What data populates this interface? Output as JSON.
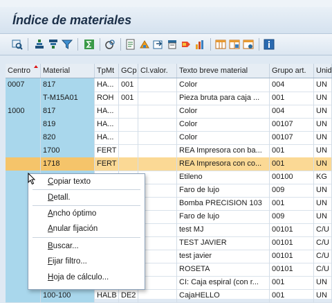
{
  "window": {
    "title": "Índice de materiales"
  },
  "toolbar": {
    "icons": [
      "details-icon",
      "sort-ascending-icon",
      "sort-descending-icon",
      "filter-icon",
      "sum-icon",
      "subtotals-icon",
      "print-preview-icon",
      "export-icon",
      "graphic-icon",
      "mail-icon",
      "abc-analysis-icon",
      "change-layout-icon",
      "select-layout-icon",
      "save-layout-icon",
      "information-icon"
    ]
  },
  "table": {
    "columns": [
      "Centro",
      "Material",
      "TpMt",
      "GCp",
      "Cl.valor.",
      "Texto breve material",
      "Grupo art.",
      "Unid"
    ],
    "rows": [
      {
        "centro": "0007",
        "material": "817",
        "tpmt": "HA...",
        "gcp": "001",
        "clvalor": "",
        "texto": "Color",
        "grupo": "004",
        "unid": "UN"
      },
      {
        "centro": "",
        "material": "T-M15A01",
        "tpmt": "ROH",
        "gcp": "001",
        "clvalor": "",
        "texto": "Pieza bruta para caja ...",
        "grupo": "001",
        "unid": "UN"
      },
      {
        "centro": "1000",
        "material": "817",
        "tpmt": "HA...",
        "gcp": "",
        "clvalor": "",
        "texto": "Color",
        "grupo": "004",
        "unid": "UN"
      },
      {
        "centro": "",
        "material": "819",
        "tpmt": "HA...",
        "gcp": "",
        "clvalor": "",
        "texto": "Color",
        "grupo": "00107",
        "unid": "UN"
      },
      {
        "centro": "",
        "material": "820",
        "tpmt": "HA...",
        "gcp": "",
        "clvalor": "",
        "texto": "Color",
        "grupo": "00107",
        "unid": "UN"
      },
      {
        "centro": "",
        "material": "1700",
        "tpmt": "FERT",
        "gcp": "",
        "clvalor": "",
        "texto": "REA Impresora con ba...",
        "grupo": "001",
        "unid": "UN"
      },
      {
        "centro": "",
        "material": "1718",
        "tpmt": "FERT",
        "gcp": "",
        "clvalor": "",
        "texto": "REA Impresora con co...",
        "grupo": "001",
        "unid": "UN"
      },
      {
        "centro": "",
        "material": "",
        "tpmt": "",
        "gcp": "",
        "clvalor": "",
        "texto": "Etileno",
        "grupo": "00100",
        "unid": "KG"
      },
      {
        "centro": "",
        "material": "",
        "tpmt": "",
        "gcp": "",
        "clvalor": "",
        "texto": "Faro de lujo",
        "grupo": "009",
        "unid": "UN"
      },
      {
        "centro": "",
        "material": "",
        "tpmt": "",
        "gcp": "",
        "clvalor": "",
        "texto": "Bomba PRECISION 103",
        "grupo": "001",
        "unid": "UN"
      },
      {
        "centro": "",
        "material": "",
        "tpmt": "",
        "gcp": "",
        "clvalor": "",
        "texto": "Faro de lujo",
        "grupo": "009",
        "unid": "UN"
      },
      {
        "centro": "",
        "material": "",
        "tpmt": "",
        "gcp": "",
        "clvalor": "",
        "texto": "test MJ",
        "grupo": "00101",
        "unid": "C/U"
      },
      {
        "centro": "",
        "material": "",
        "tpmt": "",
        "gcp": "",
        "clvalor": "",
        "texto": "TEST JAVIER",
        "grupo": "00101",
        "unid": "C/U"
      },
      {
        "centro": "",
        "material": "",
        "tpmt": "",
        "gcp": "",
        "clvalor": "",
        "texto": "test javier",
        "grupo": "00101",
        "unid": "C/U"
      },
      {
        "centro": "",
        "material": "",
        "tpmt": "",
        "gcp": "",
        "clvalor": "",
        "texto": "ROSETA",
        "grupo": "00101",
        "unid": "C/U"
      },
      {
        "centro": "",
        "material": "",
        "tpmt": "",
        "gcp": "",
        "clvalor": "",
        "texto": "CI: Caja espiral (con r...",
        "grupo": "001",
        "unid": "UN"
      },
      {
        "centro": "",
        "material": "100-100",
        "tpmt": "HALB",
        "gcp": "DE2",
        "clvalor": "",
        "texto": "CajaHELLO",
        "grupo": "001",
        "unid": "UN"
      }
    ]
  },
  "context_menu": {
    "items": [
      {
        "label": "Copiar texto"
      },
      {
        "label": "Detall."
      },
      {
        "label": "Ancho óptimo"
      },
      {
        "label": "Anular fijación"
      },
      {
        "label": "Buscar..."
      },
      {
        "label": "Fijar filtro..."
      },
      {
        "label": "Hoja de cálculo..."
      }
    ]
  },
  "colors": {
    "key_column": "#a9d7ec",
    "selected_row": "#fbd995",
    "title_text": "#1b2f48"
  }
}
